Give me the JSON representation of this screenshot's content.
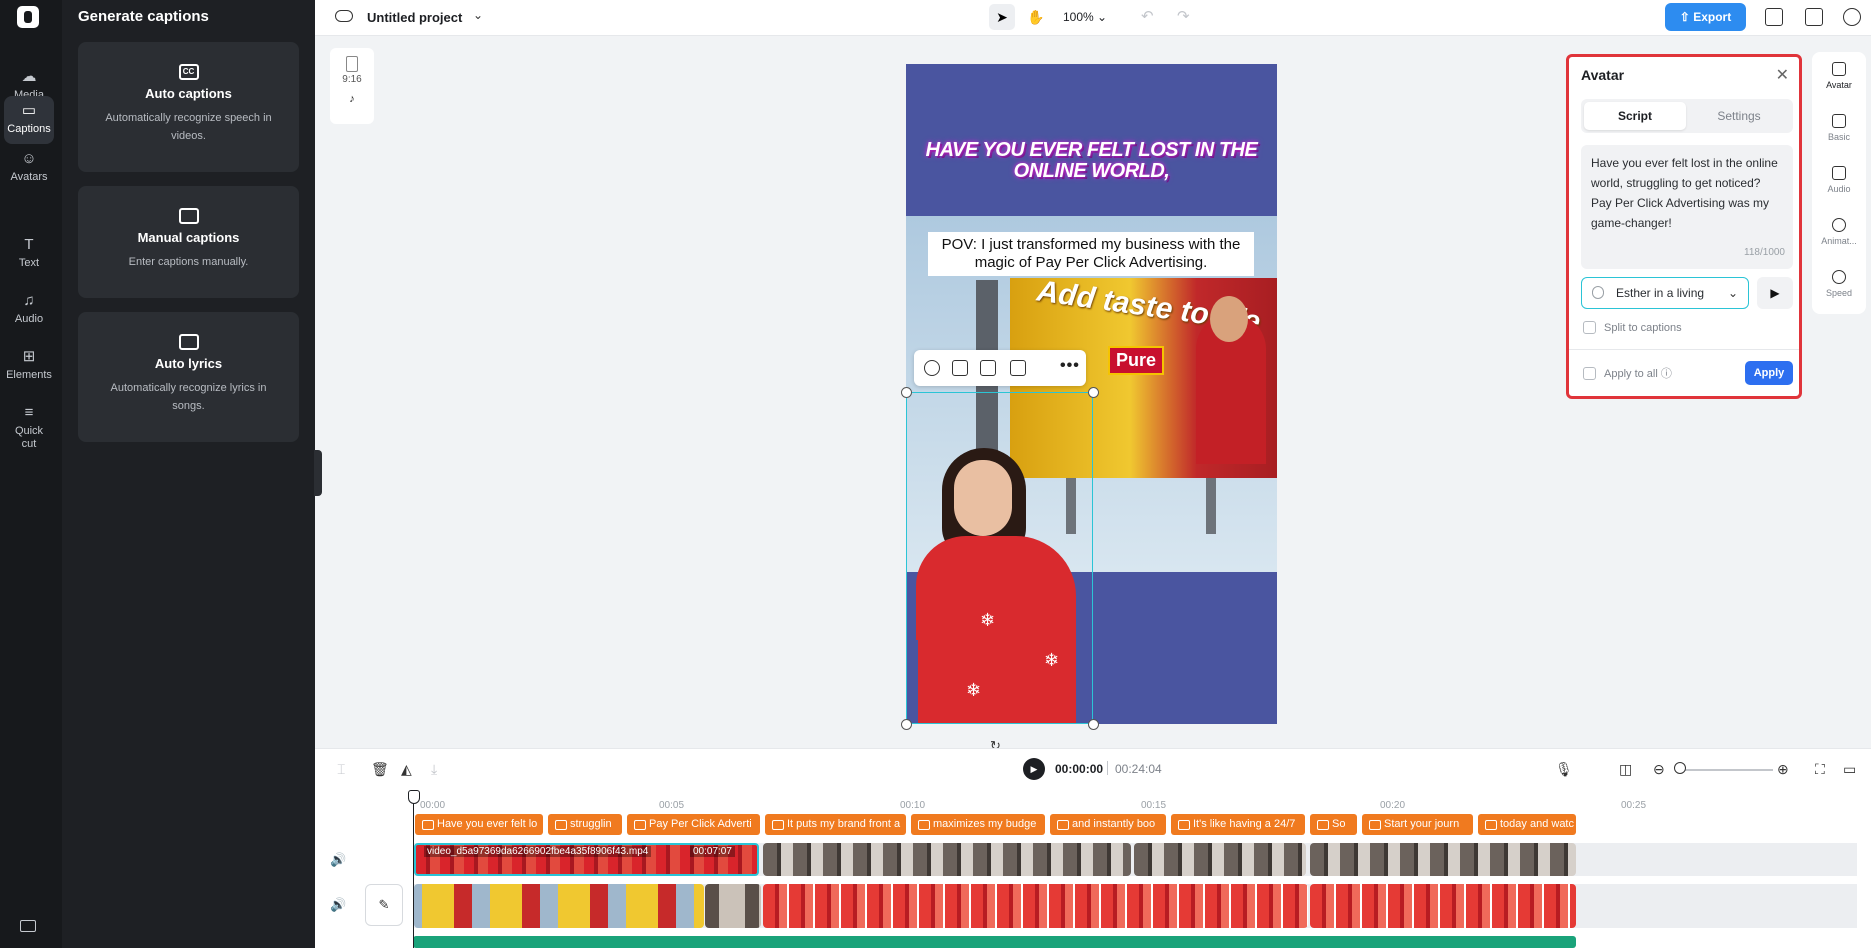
{
  "rail": {
    "items": [
      {
        "label": "Media",
        "icon": "media-icon"
      },
      {
        "label": "Captions",
        "icon": "captions-icon"
      },
      {
        "label": "Avatars",
        "icon": "avatars-icon"
      },
      {
        "label": "Text",
        "icon": "text-icon"
      },
      {
        "label": "Audio",
        "icon": "audio-icon"
      },
      {
        "label": "Elements",
        "icon": "elements-icon"
      },
      {
        "label": "Quick cut",
        "icon": "quick-cut-icon"
      }
    ],
    "active": "Captions"
  },
  "caption_panel": {
    "title": "Generate captions",
    "cards": [
      {
        "title": "Auto captions",
        "desc": "Automatically recognize speech in videos.",
        "icon": "cc-icon"
      },
      {
        "title": "Manual captions",
        "desc": "Enter captions manually.",
        "icon": "keyboard-icon"
      },
      {
        "title": "Auto lyrics",
        "desc": "Automatically recognize lyrics in songs.",
        "icon": "lyrics-icon"
      }
    ]
  },
  "topbar": {
    "project_title": "Untitled project",
    "zoom": "100%",
    "export_label": "Export"
  },
  "canvas": {
    "aspect_ratio": "9:16",
    "platform_icon": "tiktok-icon",
    "headline": "HAVE YOU EVER FELT LOST IN THE ONLINE WORLD,",
    "pov_caption": "POV: I just transformed my business with the magic of Pay Per Click Advertising.",
    "billboard_text": "Add taste to life",
    "billboard_brand": "Pure"
  },
  "avatar_panel": {
    "title": "Avatar",
    "tabs": [
      "Script",
      "Settings"
    ],
    "active_tab": "Script",
    "script": "Have you ever felt lost in the online world, struggling to get noticed? Pay Per Click Advertising was my game-changer!",
    "char_count": "118/1000",
    "voice": "Esther in a living",
    "split_label": "Split to captions",
    "apply_all_label": "Apply to all",
    "apply_label": "Apply",
    "accent": "#e0343a"
  },
  "right_rail": [
    {
      "label": "Avatar"
    },
    {
      "label": "Basic"
    },
    {
      "label": "Audio"
    },
    {
      "label": "Animat..."
    },
    {
      "label": "Speed"
    }
  ],
  "timeline": {
    "current_time": "00:00:00",
    "total_time": "00:24:04",
    "ruler": [
      "00:00",
      "00:05",
      "00:10",
      "00:15",
      "00:20",
      "00:25"
    ],
    "captions": [
      "Have you ever felt lo",
      "strugglin",
      "Pay Per Click Adverti",
      "It puts my brand front a",
      "maximizes my budge",
      "and instantly boo",
      "It's like having a 24/7",
      "So",
      "Start your journ",
      "today and watc"
    ],
    "avatar_clip_name": "video_d5a97369da6266902fbe4a35f8906f43.mp4",
    "avatar_clip_duration": "00:07:07"
  }
}
